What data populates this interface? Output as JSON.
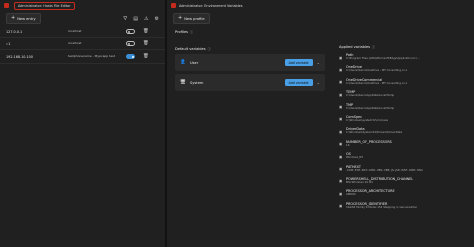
{
  "hosts_editor": {
    "title": "Administrator: Hosts File Editor",
    "new_entry_label": "New entry",
    "entries": [
      {
        "address": "127.0.0.1",
        "hosts": "localhost",
        "enabled": false
      },
      {
        "address": "::1",
        "hosts": "localhost",
        "enabled": false
      },
      {
        "address": "192.168.10.100",
        "hosts": "testphonename - Mypcapp test",
        "enabled": true
      }
    ]
  },
  "env_vars": {
    "title": "Administrator: Environment Variables",
    "new_profile_label": "New profile",
    "profiles_label": "Profiles",
    "default_variables_label": "Default variables",
    "applied_variables_label": "Applied variables",
    "add_variable_label": "Add variable",
    "groups": [
      {
        "label": "User"
      },
      {
        "label": "System"
      }
    ],
    "applied": [
      {
        "name": "Path",
        "value": "C:\\Program Files (x86)\\Microsoft\\Edge\\Application;C:\\..."
      },
      {
        "name": "OneDrive",
        "value": "C:\\Users\\lbenn\\OneDrive - MT Consulting.co.z"
      },
      {
        "name": "OneDriveCommercial",
        "value": "C:\\Users\\lbenn\\OneDrive - MT Consulting.co.z"
      },
      {
        "name": "TEMP",
        "value": "C:\\Users\\lbenn\\AppData\\Local\\Temp"
      },
      {
        "name": "TMP",
        "value": "C:\\Users\\lbenn\\AppData\\Local\\Temp"
      },
      {
        "name": "ComSpec",
        "value": "C:\\Windows\\system32\\cmd.exe"
      },
      {
        "name": "DriverData",
        "value": "C:\\Windows\\System32\\Drivers\\DriverData"
      },
      {
        "name": "NUMBER_OF_PROCESSORS",
        "value": "16"
      },
      {
        "name": "OS",
        "value": "Windows_NT"
      },
      {
        "name": "PATHEXT",
        "value": ".COM;.EXE;.BAT;.CMD;.VBS;.VBE;.JS;.JSE;.WSF;.WSH;.MSC"
      },
      {
        "name": "POWERSHELL_DISTRIBUTION_CHANNEL",
        "value": "MSI:Windows 10 Pro"
      },
      {
        "name": "PROCESSOR_ARCHITECTURE",
        "value": "AMD64"
      },
      {
        "name": "PROCESSOR_IDENTIFIER",
        "value": "Intel64 Family 6 Model 154 Stepping 4, GenuineIntel"
      }
    ]
  }
}
